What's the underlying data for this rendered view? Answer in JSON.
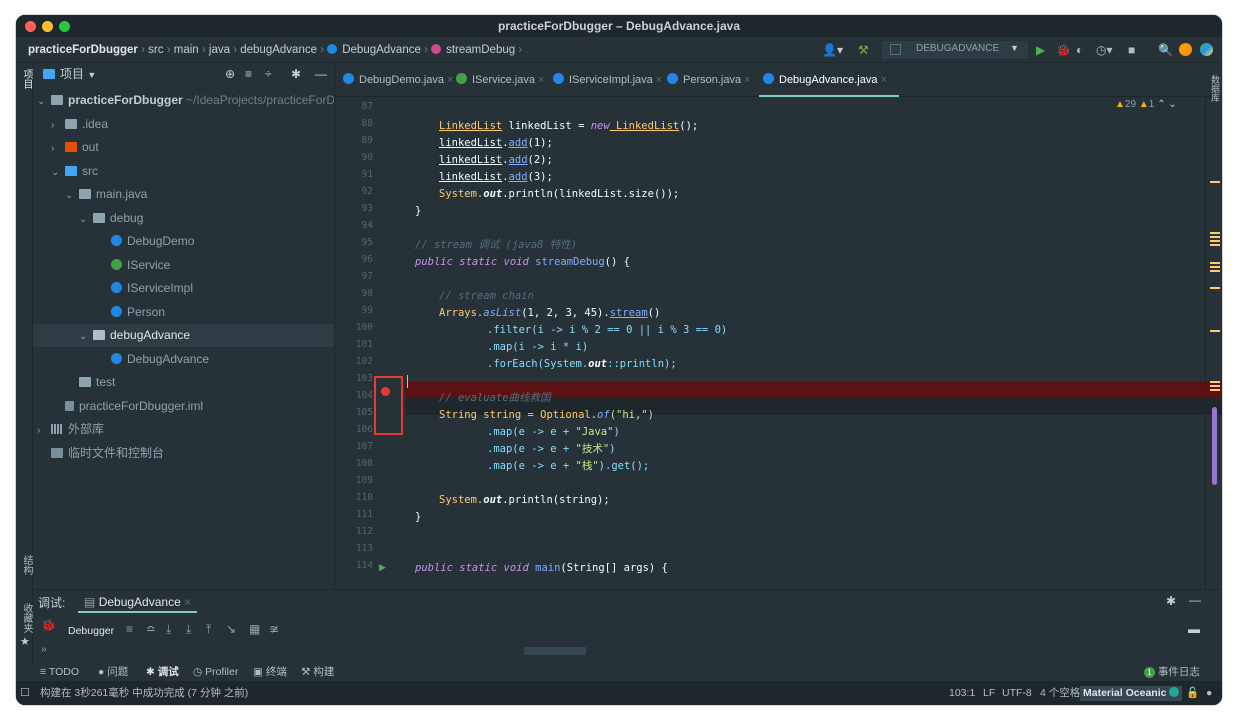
{
  "window": {
    "title": "practiceForDbugger – DebugAdvance.java"
  },
  "breadcrumb": [
    "practiceForDbugger",
    "src",
    "main",
    "java",
    "debugAdvance",
    "DebugAdvance",
    "streamDebug"
  ],
  "toolbar": {
    "run_config": "DEBUGADVANCE"
  },
  "strip": {
    "project": "项目",
    "structure": "结构",
    "favorites": "收藏夹",
    "database": "数据库"
  },
  "project": {
    "header": "项目",
    "root_name": "practiceForDbugger",
    "root_path": "~/IdeaProjects/practiceForDl",
    "items": [
      ".idea",
      "out",
      "src",
      "main.java",
      "debug",
      "DebugDemo",
      "IService",
      "IServiceImpl",
      "Person",
      "debugAdvance",
      "DebugAdvance",
      "test",
      "practiceForDbugger.iml",
      "外部库",
      "临时文件和控制台"
    ]
  },
  "tabs": [
    "DebugDemo.java",
    "IService.java",
    "IServiceImpl.java",
    "Person.java",
    "DebugAdvance.java"
  ],
  "inspection": {
    "warnings": "29",
    "weak": "1"
  },
  "code": {
    "line_numbers": [
      "87",
      "88",
      "89",
      "90",
      "91",
      "92",
      "93",
      "94",
      "95",
      "96",
      "97",
      "98",
      "99",
      "100",
      "101",
      "102",
      "103",
      "104",
      "105",
      "106",
      "107",
      "108",
      "109",
      "110",
      "111",
      "112",
      "113",
      "114"
    ],
    "l88a": "LinkedList",
    "l88b": " linkedList = ",
    "l88c": "new",
    "l88d": " LinkedList",
    "l88e": "();",
    "l89a": "linkedList",
    "l89b": ".",
    "l89c": "add",
    "l89d": "(1);",
    "l90a": "linkedList",
    "l90b": ".",
    "l90c": "add",
    "l90d": "(2);",
    "l91a": "linkedList",
    "l91b": ".",
    "l91c": "add",
    "l91d": "(3);",
    "l92a": "System.",
    "l92b": "out",
    "l92c": ".println(linkedList.size());",
    "l93": "}",
    "l95": "// stream 调试 (java8 特性)",
    "l96a": "public static void",
    "l96b": " streamDebug",
    "l96c": "() {",
    "l98": "// stream chain",
    "l99a": "Arrays.",
    "l99b": "asList",
    "l99c": "(1, 2, 3, 45).",
    "l99d": "stream",
    "l99e": "()",
    "l100": ".filter(i -> i % 2 == 0 || i % 3 == 0)",
    "l101": ".map(i -> i * i)",
    "l102a": ".forEach(System.",
    "l102b": "out",
    "l102c": "::println);",
    "l104": "// evaluate曲线救国",
    "l105a": "String string = Optional.",
    "l105b": "of",
    "l105c": "(\"hi,\")",
    "l106a": ".map(e -> e + ",
    "l106b": "\"Java\"",
    "l106c": ")",
    "l107a": ".map(e -> e + ",
    "l107b": "\"技术\"",
    "l107c": ")",
    "l108a": ".map(e -> e + ",
    "l108b": "\"栈\"",
    "l108c": ").get();",
    "l110a": "System.",
    "l110b": "out",
    "l110c": ".println(string);",
    "l111": "}",
    "l114a": "public static void",
    "l114b": " main",
    "l114c": "(String[] args) {"
  },
  "debug": {
    "label": "调试:",
    "session": "DebugAdvance",
    "debugger_tab": "Debugger"
  },
  "bottom_tabs": [
    "TODO",
    "问题",
    "调试",
    "Profiler",
    "终端",
    "构建"
  ],
  "event_log": "事件日志",
  "event_count": "1",
  "status": {
    "message": "构建在 3秒261毫秒 中成功完成 (7 分钟 之前)",
    "position": "103:1",
    "line_sep": "LF",
    "encoding": "UTF-8",
    "indent": "4 个空格",
    "theme": "Material Oceanic"
  },
  "colors": {
    "accent": "#80cbc4",
    "breakpoint": "#e53935",
    "bp_line": "#5c1212"
  }
}
